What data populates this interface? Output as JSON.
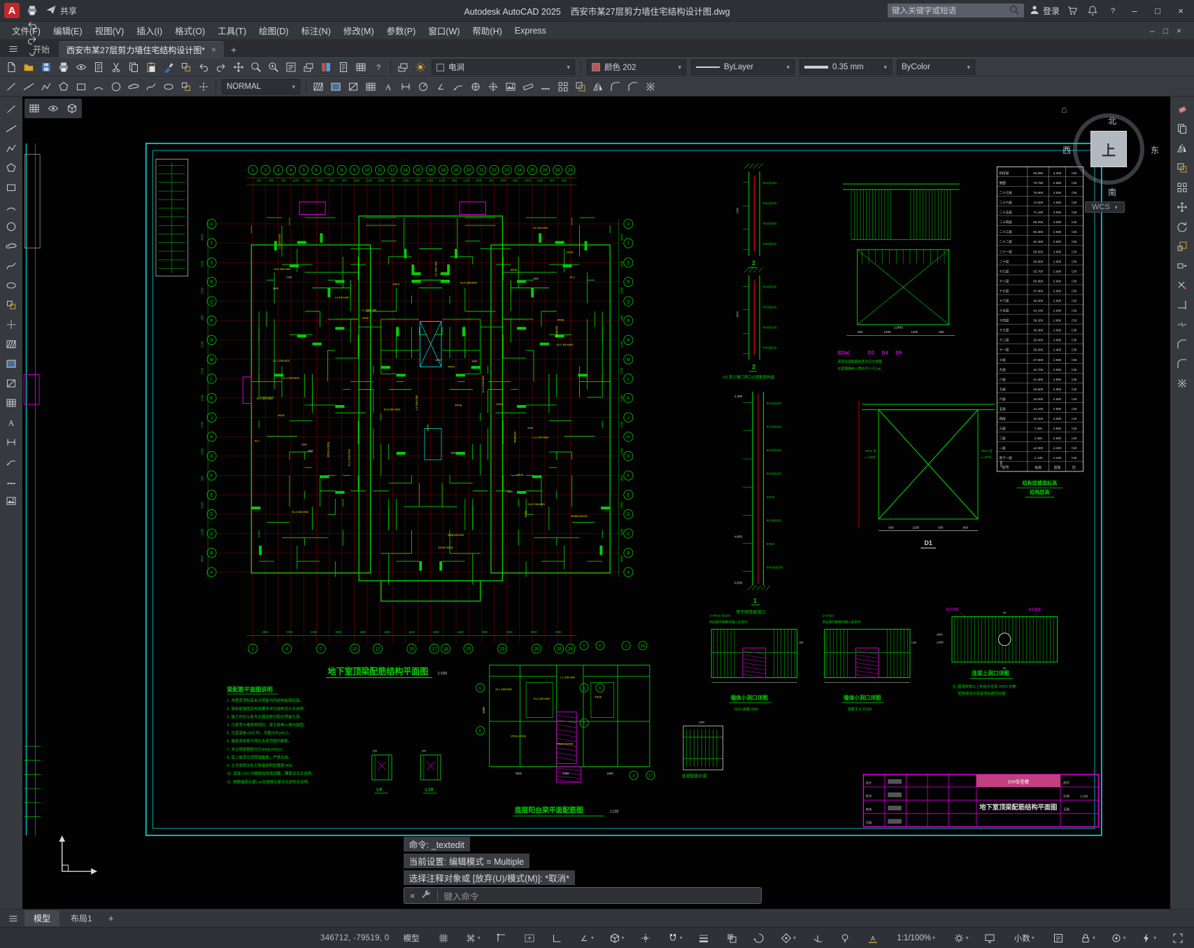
{
  "titlebar": {
    "logo_letter": "A",
    "quick_access": [
      {
        "name": "new-file-icon",
        "k": "newdoc"
      },
      {
        "name": "open-file-icon",
        "k": "folder"
      },
      {
        "name": "save-icon",
        "k": "disk"
      },
      {
        "name": "plot-icon",
        "k": "printer"
      },
      {
        "name": "undo-icon",
        "k": "undo"
      },
      {
        "name": "redo-icon",
        "k": "redo"
      },
      {
        "name": "quick-access-customize-icon",
        "k": "chev"
      }
    ],
    "share_label": "共享",
    "app_title": "Autodesk AutoCAD 2025",
    "doc_title": "西安市某27层剪力墙住宅结构设计图.dwg",
    "search_placeholder": "键入关键字或短语",
    "sign_in_label": "登录",
    "win_min": "–",
    "win_max": "□",
    "win_close": "×"
  },
  "menubar": {
    "items": [
      "文件(F)",
      "编辑(E)",
      "视图(V)",
      "插入(I)",
      "格式(O)",
      "工具(T)",
      "绘图(D)",
      "标注(N)",
      "修改(M)",
      "参数(P)",
      "窗口(W)",
      "帮助(H)",
      "Express"
    ],
    "names": [
      "menu-file",
      "menu-edit",
      "menu-view",
      "menu-insert",
      "menu-format",
      "menu-tools",
      "menu-draw",
      "menu-dimension",
      "menu-modify",
      "menu-parametric",
      "menu-window",
      "menu-help",
      "menu-express"
    ],
    "win_min": "–",
    "win_max": "□",
    "win_close": "×"
  },
  "filetabs": {
    "start_tab": "开始",
    "doc_tab": "西安市某27层剪力墙住宅结构设计图*",
    "close_glyph": "×",
    "new_tab_glyph": "+"
  },
  "toolbar1": {
    "icons": [
      {
        "name": "new-icon",
        "k": "newdoc"
      },
      {
        "name": "open-icon",
        "k": "folder"
      },
      {
        "name": "save-icon",
        "k": "disk"
      },
      {
        "name": "plot-icon",
        "k": "printer"
      },
      {
        "name": "plot-preview-icon",
        "k": "eye"
      },
      {
        "name": "publish-icon",
        "k": "doc"
      },
      {
        "name": "cut-icon",
        "k": "cut"
      },
      {
        "name": "copy-clip-icon",
        "k": "copy"
      },
      {
        "name": "paste-icon",
        "k": "paste"
      },
      {
        "name": "match-properties-icon",
        "k": "brush"
      },
      {
        "name": "block-editor-icon",
        "k": "insert"
      },
      {
        "name": "undo-icon",
        "k": "undo"
      },
      {
        "name": "redo-icon",
        "k": "redo"
      },
      {
        "name": "pan-icon",
        "k": "pan"
      },
      {
        "name": "zoom-icon",
        "k": "zoom"
      },
      {
        "name": "zoom-window-icon",
        "k": "zoomprev"
      },
      {
        "name": "properties-icon",
        "k": "props"
      },
      {
        "name": "design-center-icon",
        "k": "stack"
      },
      {
        "name": "tool-palettes-icon",
        "k": "palette"
      },
      {
        "name": "sheet-set-icon",
        "k": "doc"
      },
      {
        "name": "quick-calc-icon",
        "k": "table"
      },
      {
        "name": "help-icon",
        "k": "question"
      }
    ],
    "layer_icons": [
      {
        "name": "layer-properties-icon",
        "k": "stack"
      },
      {
        "name": "layer-states-icon",
        "k": "sun"
      }
    ],
    "layer_value": "电涧",
    "color_value": "颜色 202",
    "linetype_value": "ByLayer",
    "lineweight_value": "0.35 mm",
    "plotstyle_value": "ByColor"
  },
  "toolbar2": {
    "left_icons": [
      {
        "name": "line-tool",
        "k": "line"
      },
      {
        "name": "construction-line-tool",
        "k": "xline"
      },
      {
        "name": "polyline-tool",
        "k": "pline"
      },
      {
        "name": "polygon-tool",
        "k": "polygon"
      },
      {
        "name": "rectangle-tool",
        "k": "rect"
      },
      {
        "name": "arc-tool",
        "k": "arc"
      },
      {
        "name": "circle-tool",
        "k": "circle"
      },
      {
        "name": "revision-cloud-tool",
        "k": "revcloud"
      },
      {
        "name": "spline-tool",
        "k": "spline"
      },
      {
        "name": "ellipse-tool",
        "k": "ellipse"
      },
      {
        "name": "insert-block-tool",
        "k": "insert"
      },
      {
        "name": "point-tool",
        "k": "point"
      }
    ],
    "style_value": "NORMAL",
    "right_icons": [
      {
        "name": "hatch-tool",
        "k": "hatch"
      },
      {
        "name": "gradient-tool",
        "k": "gradient"
      },
      {
        "name": "boundary-tool",
        "k": "region"
      },
      {
        "name": "table-tool",
        "k": "table"
      },
      {
        "name": "multiline-text-tool",
        "k": "mtextA"
      },
      {
        "name": "linear-dimension-tool",
        "k": "dimlin"
      },
      {
        "name": "radius-dimension-tool",
        "k": "dimrad"
      },
      {
        "name": "angular-dimension-tool",
        "k": "dimang"
      },
      {
        "name": "leader-tool",
        "k": "leader"
      },
      {
        "name": "tolerance-tool",
        "k": "tol"
      },
      {
        "name": "center-mark-tool",
        "k": "centerm"
      },
      {
        "name": "image-attach-tool",
        "k": "image"
      },
      {
        "name": "measure-tool",
        "k": "ruler"
      },
      {
        "name": "divide-tool",
        "k": "divide"
      },
      {
        "name": "array-tool",
        "k": "array"
      },
      {
        "name": "offset-tool",
        "k": "offset"
      },
      {
        "name": "mirror-tool",
        "k": "mirror"
      },
      {
        "name": "fillet-tool",
        "k": "fillet"
      },
      {
        "name": "chamfer-tool",
        "k": "chamfer"
      },
      {
        "name": "explode-tool",
        "k": "explode"
      }
    ]
  },
  "mini_toolbar": [
    {
      "name": "viewport-dialog-icon",
      "k": "table"
    },
    {
      "name": "named-views-icon",
      "k": "eye"
    },
    {
      "name": "3d-views-icon",
      "k": "iso"
    }
  ],
  "left_toolbox": [
    {
      "name": "line-tool",
      "k": "line"
    },
    {
      "name": "construction-line-tool",
      "k": "xline"
    },
    {
      "name": "polyline-tool",
      "k": "pline"
    },
    {
      "name": "polygon-tool",
      "k": "polygon"
    },
    {
      "name": "rectangle-tool",
      "k": "rect"
    },
    {
      "name": "arc-tool",
      "k": "arc"
    },
    {
      "name": "circle-tool",
      "k": "circle"
    },
    {
      "name": "revision-cloud-tool",
      "k": "revcloud"
    },
    {
      "name": "spline-tool",
      "k": "spline"
    },
    {
      "name": "ellipse-tool",
      "k": "ellipse"
    },
    {
      "name": "insert-block-tool",
      "k": "insert"
    },
    {
      "name": "point-tool",
      "k": "point"
    },
    {
      "name": "hatch-tool",
      "k": "hatch"
    },
    {
      "name": "gradient-tool",
      "k": "gradient"
    },
    {
      "name": "boundary-tool",
      "k": "region"
    },
    {
      "name": "table-tool",
      "k": "table"
    },
    {
      "name": "text-tool",
      "k": "mtextA"
    },
    {
      "name": "linear-dimension-tool",
      "k": "dimlin"
    },
    {
      "name": "leader-tool",
      "k": "leader"
    },
    {
      "name": "divide-tool",
      "k": "divide"
    },
    {
      "name": "image-attach-tool",
      "k": "image"
    }
  ],
  "right_toolbox": [
    {
      "name": "erase-tool",
      "k": "erase"
    },
    {
      "name": "copy-tool",
      "k": "copy"
    },
    {
      "name": "mirror-tool",
      "k": "mirror"
    },
    {
      "name": "offset-tool",
      "k": "offset"
    },
    {
      "name": "array-tool",
      "k": "array"
    },
    {
      "name": "move-tool",
      "k": "pan"
    },
    {
      "name": "rotate-tool",
      "k": "rotate"
    },
    {
      "name": "scale-tool",
      "k": "scale"
    },
    {
      "name": "stretch-tool",
      "k": "stretch"
    },
    {
      "name": "trim-tool",
      "k": "trim"
    },
    {
      "name": "extend-tool",
      "k": "extend"
    },
    {
      "name": "break-tool",
      "k": "breakk"
    },
    {
      "name": "chamfer-tool",
      "k": "chamfer"
    },
    {
      "name": "fillet-tool",
      "k": "fillet"
    },
    {
      "name": "explode-tool",
      "k": "explode"
    }
  ],
  "viewcube": {
    "north": "北",
    "south": "南",
    "east": "东",
    "west": "西",
    "top_face": "上",
    "wcs_label": "WCS",
    "home_glyph": "⌂"
  },
  "cmd": {
    "history": [
      "命令: _textedit",
      "当前设置: 编辑模式 = Multiple",
      "选择注释对象或 [放弃(U)/模式(M)]: *取消*"
    ],
    "placeholder": "键入命令",
    "close_glyph": "×"
  },
  "layoutbar": {
    "model_tab": "模型",
    "layout1_tab": "布局1",
    "add_glyph": "+"
  },
  "statusbar": {
    "coords": "346712, -79519, 0",
    "items": [
      {
        "name": "model-space-button",
        "label": "模型"
      },
      {
        "name": "grid-display-toggle",
        "k": "grid"
      },
      {
        "name": "snap-mode-toggle",
        "k": "snapgrid",
        "caret": true
      },
      {
        "name": "infer-constraints-toggle",
        "k": "infer"
      },
      {
        "name": "dynamic-input-toggle",
        "k": "dyn"
      },
      {
        "name": "ortho-mode-toggle",
        "k": "ortho"
      },
      {
        "name": "polar-tracking-toggle",
        "k": "dimang",
        "caret": true
      },
      {
        "name": "isometric-drafting-toggle",
        "k": "iso",
        "caret": true
      },
      {
        "name": "object-snap-tracking-toggle",
        "k": "track"
      },
      {
        "name": "object-snap-toggle",
        "k": "magnet",
        "caret": true
      },
      {
        "name": "lineweight-display-toggle",
        "k": "lw"
      },
      {
        "name": "transparency-toggle",
        "k": "transp"
      },
      {
        "name": "selection-cycling-toggle",
        "k": "cycle"
      },
      {
        "name": "3d-object-snap-toggle",
        "k": "osnap3d",
        "caret": true
      },
      {
        "name": "dynamic-ucs-toggle",
        "k": "ucsdyn"
      },
      {
        "name": "annotation-visibility-toggle",
        "k": "bulb"
      },
      {
        "name": "autoscale-toggle",
        "k": "autoscale"
      },
      {
        "name": "annotation-scale-button",
        "label": "1:1/100%",
        "caret": true
      },
      {
        "name": "workspace-switching-button",
        "k": "gear",
        "caret": true
      },
      {
        "name": "annotation-monitor-toggle",
        "k": "monitor"
      },
      {
        "name": "units-button",
        "label": "小数",
        "caret": true
      },
      {
        "name": "quick-properties-toggle",
        "k": "qp"
      },
      {
        "name": "lock-ui-button",
        "k": "lock",
        "caret": true
      },
      {
        "name": "isolate-objects-button",
        "k": "isolate",
        "caret": true
      },
      {
        "name": "graphics-performance-toggle",
        "k": "perf",
        "caret": true
      },
      {
        "name": "clean-screen-button",
        "k": "clean"
      }
    ]
  },
  "drawing": {
    "main_title": "地下室顶梁配筋结构平面图",
    "main_scale": "1:100",
    "axes_top": [
      "1",
      "2",
      "3",
      "4",
      "5",
      "6",
      "7",
      "8",
      "9",
      "10",
      "11",
      "12",
      "14",
      "15",
      "16",
      "18",
      "19",
      "20",
      "21",
      "22",
      "23",
      "24",
      "25",
      "26",
      "28",
      "29"
    ],
    "axes_bottom": [
      "1",
      "4",
      "7",
      "10",
      "12",
      "15",
      "17",
      "18",
      "20",
      "23",
      "26",
      "28",
      "29"
    ],
    "axes_left": [
      "U",
      "T",
      "S",
      "R",
      "Q",
      "P",
      "N",
      "M",
      "L",
      "K",
      "J",
      "H",
      "G",
      "F",
      "E",
      "D",
      "C",
      "B",
      "A"
    ],
    "dims_top": [
      "100",
      "900",
      "300",
      "1200",
      "1500",
      "900",
      "600",
      "300",
      "1800",
      "2100",
      "2100",
      "900",
      "2100",
      "1500",
      "2100",
      "2100",
      "900",
      "2100",
      "1800",
      "300",
      "600",
      "900",
      "1500",
      "1200",
      "300",
      "900"
    ],
    "dims_bottom": [
      "3300",
      "3300",
      "3300",
      "3000",
      "1800",
      "1800",
      "1600",
      "1800",
      "1800",
      "3000",
      "3300",
      "3300",
      "3300"
    ],
    "dims_left": [
      "4500",
      "2100",
      "1500",
      "900",
      "2100",
      "2700",
      "2100",
      "2700",
      "2100",
      "900",
      "1500",
      "2100",
      "4500"
    ],
    "plan_white_dims": [
      "2100",
      "1800",
      "1500",
      "3300"
    ],
    "beam_labels": [
      "KL1 300×600",
      "KL2 250×500",
      "L1 200×400",
      "4Φ18",
      "2Φ16+2Φ18",
      "Φ8@100/200",
      "KL3 300×550",
      "L5 200×450",
      "3Φ20",
      "LL1 200×500",
      "2Φ20",
      "Φ8@200",
      "KL6 250×600",
      "6Φ18",
      "L3 200×350",
      "AL1",
      "2Φ14",
      "3Φ18"
    ],
    "notes_title": "梁配筋平面图说明",
    "notes": [
      "1. 本图梁顶标高未注明者均同结构板面标高。",
      "2. 梁纵筋锚固及构造要求详见结构设计总说明。",
      "3. 施工时应与各专业图纸密切配合预留孔洞。",
      "4. 凡梁宽与墙厚相同时，梁主筋伸入墙内锚固。",
      "5. 次梁梁高<500 时，吊筋均为2Φ12。",
      "6. 悬挑梁面筋不得在支座范围内截断。",
      "7. 未注明梁箍筋均为Φ8@200(2)。",
      "8. 梁上留洞均须预埋套管，严禁后凿。",
      "9. 主次梁相交处主梁每侧附加箍筋3Φ8。",
      "10. 梁宽<250 时箍筋按构造调整，腰筋详见总说明。",
      "11. 钢筋锚固长度Lae及搭接长度详见结构总说明。"
    ],
    "balcony_title": "底层阳台梁平面配筋图",
    "balcony_scale": "1:100",
    "balcony_dims": [
      "3300",
      "2400",
      "1500"
    ],
    "balcony_bubbles": [
      "U",
      "D",
      "T",
      "F",
      "Q",
      "D",
      "C",
      "1",
      "29",
      "3",
      "17"
    ],
    "floor_table": {
      "caption_line1": "结构层楼面标高",
      "caption_line2": "结构层高",
      "header": [
        "层号",
        "标高",
        "层高",
        "砼"
      ],
      "rows": [
        [
          "机房层",
          "83.080",
          "3.300",
          "C25"
        ],
        [
          "屋面",
          "79.780",
          "2.880",
          "C25"
        ],
        [
          "二十七层",
          "76.900",
          "2.900",
          "C25"
        ],
        [
          "二十六层",
          "74.000",
          "2.900",
          "C25"
        ],
        [
          "二十五层",
          "71.100",
          "2.900",
          "C25"
        ],
        [
          "二十四层",
          "68.200",
          "2.900",
          "C25"
        ],
        [
          "二十三层",
          "65.300",
          "2.900",
          "C25"
        ],
        [
          "二十二层",
          "62.400",
          "2.900",
          "C25"
        ],
        [
          "二十一层",
          "59.500",
          "2.900",
          "C30"
        ],
        [
          "二十层",
          "56.600",
          "2.900",
          "C30"
        ],
        [
          "十九层",
          "53.700",
          "2.900",
          "C30"
        ],
        [
          "十八层",
          "50.800",
          "2.900",
          "C30"
        ],
        [
          "十七层",
          "47.900",
          "2.900",
          "C30"
        ],
        [
          "十六层",
          "45.000",
          "2.900",
          "C30"
        ],
        [
          "十五层",
          "42.100",
          "2.900",
          "C30"
        ],
        [
          "十四层",
          "39.200",
          "2.900",
          "C30"
        ],
        [
          "十三层",
          "36.300",
          "2.900",
          "C35"
        ],
        [
          "十二层",
          "33.400",
          "2.900",
          "C35"
        ],
        [
          "十一层",
          "30.500",
          "2.900",
          "C35"
        ],
        [
          "十层",
          "27.600",
          "2.900",
          "C35"
        ],
        [
          "九层",
          "24.700",
          "2.900",
          "C35"
        ],
        [
          "八层",
          "21.800",
          "2.900",
          "C35"
        ],
        [
          "七层",
          "18.900",
          "2.900",
          "C40"
        ],
        [
          "六层",
          "16.000",
          "2.900",
          "C40"
        ],
        [
          "五层",
          "13.100",
          "2.900",
          "C40"
        ],
        [
          "四层",
          "10.200",
          "2.900",
          "C40"
        ],
        [
          "三层",
          "7.300",
          "2.900",
          "C40"
        ],
        [
          "二层",
          "4.400",
          "2.900",
          "C40"
        ],
        [
          "一层",
          "±0.000",
          "4.400",
          "C40"
        ],
        [
          "地下一层",
          "-1.100",
          "4.100",
          "C40"
        ]
      ]
    },
    "details": {
      "sec2_label": "2",
      "sec2b_label": "2",
      "d2_caption": "D2 剪力墙门洞口过梁配筋构造",
      "d2a_tags": [
        "(D2a)",
        "D3",
        "D4",
        "D5"
      ],
      "d2a_note1": "洞顶过梁配筋构造详见大样图",
      "d2a_note2": "过梁钢筋伸入墙内不小于Lae",
      "lintel_dims": [
        "600",
        "1200",
        "1200",
        "600"
      ],
      "lintel_extra": "(1300)",
      "sec1_label": "1",
      "sec1_caption": "用于砌墙留洞口",
      "rebar_texts": [
        "Φ14@150",
        "Φ12@100",
        "Φ14@150",
        "Φ16@150",
        "2Φ18",
        "Φ16@150",
        "5Φ16",
        "6Φ16@150"
      ],
      "elev_marks": [
        "-1.200",
        "-4.800",
        "-6.500"
      ],
      "d1_label": "D1",
      "d1_texts": [
        "2Φ12 合",
        "L=1000",
        "2Φ12 合",
        "L=1000"
      ],
      "d1_dims": [
        "600",
        "1200",
        "500",
        "600"
      ],
      "d1_side_dim": "1200",
      "wall_open1_title": "墙体小洞口详图",
      "wall_open1_sub": "500<洞宽<800",
      "wall_open1_note1": "2×4Φ20 @200",
      "wall_open1_note2": "洞边竖向钢筋均锚入此梁内",
      "wall_open2_title": "墙体小洞口详图",
      "wall_open2_sub": "洞宽不大于500",
      "wall_open2_note1": "2×2Φ20",
      "wall_open2_note2": "洞边竖向钢筋均锚入此梁内",
      "link_title": "连梁上洞口详图",
      "link_note1": "注: 圆洞除按以上构造外另加 2Φ10 环筋",
      "link_note2": "框架梁及次梁留洞加筋同此图",
      "link_tag": "连梁箍筋",
      "link_dim1": "≥h/3",
      "link_dim2": "≥200",
      "link_hole_dim": "50",
      "l9_label": "L9",
      "l10_label": "L10",
      "l_dim": "200",
      "beam_demo_caption": "连梁配筋示意",
      "beam_demo_dim": "1800"
    },
    "titleblock": {
      "project_label": "10#住宅楼",
      "sheet_title": "地下室顶梁配筋结构平面图",
      "fields": [
        "设计",
        "校对",
        "审核",
        "日期"
      ],
      "right_fields": [
        "图号",
        "比例",
        "日期"
      ],
      "scale_value": "1:100"
    }
  }
}
